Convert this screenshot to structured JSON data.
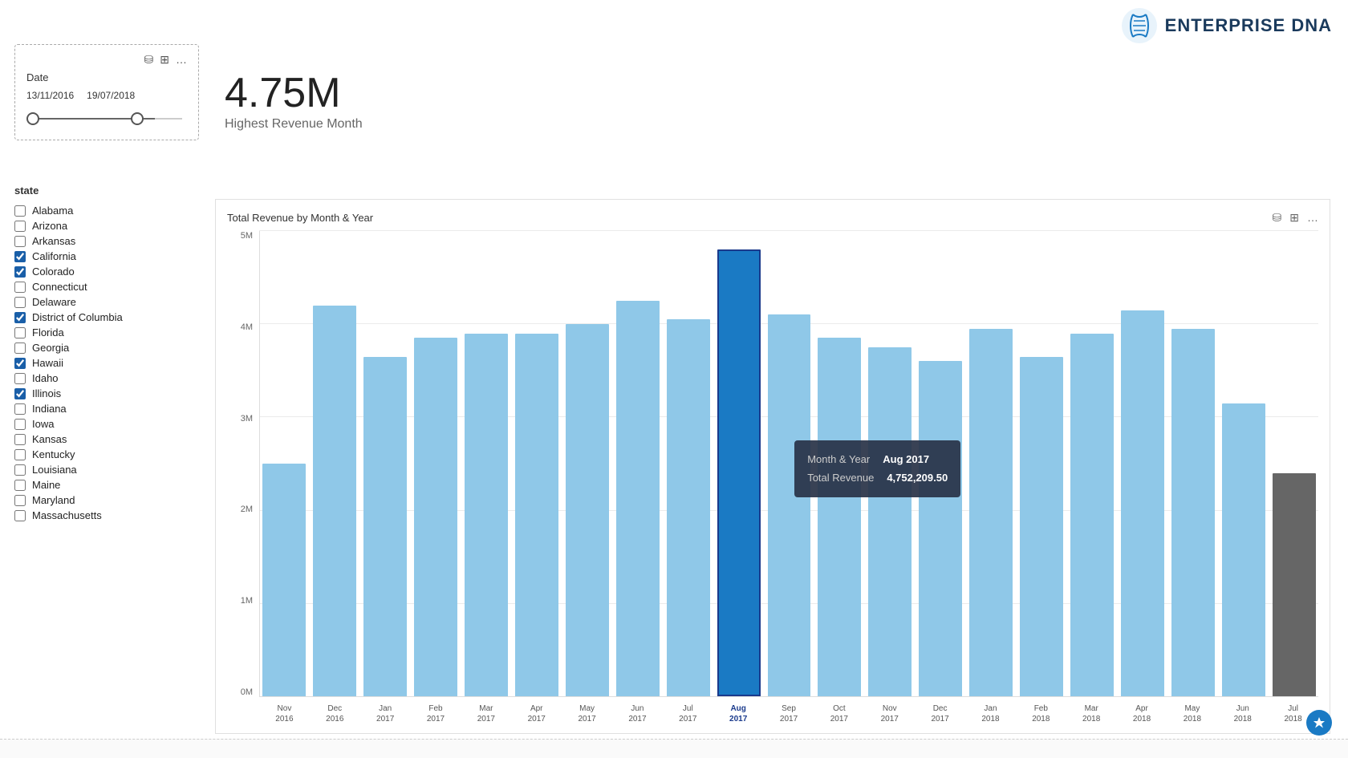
{
  "logo": {
    "text": "ENTERPRISE DNA"
  },
  "date_filter": {
    "label": "Date",
    "start": "13/11/2016",
    "end": "19/07/2018",
    "toolbar": {
      "filter_icon": "⛁",
      "table_icon": "⊞",
      "more_icon": "…"
    }
  },
  "kpi": {
    "value": "4.75M",
    "label": "Highest Revenue Month"
  },
  "state_filter": {
    "title": "state",
    "items": [
      {
        "label": "Alabama",
        "checked": false
      },
      {
        "label": "Arizona",
        "checked": false
      },
      {
        "label": "Arkansas",
        "checked": false
      },
      {
        "label": "California",
        "checked": true
      },
      {
        "label": "Colorado",
        "checked": true
      },
      {
        "label": "Connecticut",
        "checked": false
      },
      {
        "label": "Delaware",
        "checked": false
      },
      {
        "label": "District of Columbia",
        "checked": true
      },
      {
        "label": "Florida",
        "checked": false
      },
      {
        "label": "Georgia",
        "checked": false
      },
      {
        "label": "Hawaii",
        "checked": true
      },
      {
        "label": "Idaho",
        "checked": false
      },
      {
        "label": "Illinois",
        "checked": true
      },
      {
        "label": "Indiana",
        "checked": false
      },
      {
        "label": "Iowa",
        "checked": false
      },
      {
        "label": "Kansas",
        "checked": false
      },
      {
        "label": "Kentucky",
        "checked": false
      },
      {
        "label": "Louisiana",
        "checked": false
      },
      {
        "label": "Maine",
        "checked": false
      },
      {
        "label": "Maryland",
        "checked": false
      },
      {
        "label": "Massachusetts",
        "checked": false
      }
    ]
  },
  "chart": {
    "title": "Total Revenue by Month & Year",
    "y_labels": [
      "5M",
      "4M",
      "3M",
      "2M",
      "1M",
      "0M"
    ],
    "tooltip": {
      "month_year_label": "Month & Year",
      "month_year_value": "Aug 2017",
      "revenue_label": "Total Revenue",
      "revenue_value": "4,752,209.50"
    },
    "bars": [
      {
        "month": "Nov",
        "year": "2016",
        "height_pct": 50,
        "highlighted": false,
        "dark": false
      },
      {
        "month": "Dec",
        "year": "2016",
        "height_pct": 84,
        "highlighted": false,
        "dark": false
      },
      {
        "month": "Jan",
        "year": "2017",
        "height_pct": 73,
        "highlighted": false,
        "dark": false
      },
      {
        "month": "Feb",
        "year": "2017",
        "height_pct": 77,
        "highlighted": false,
        "dark": false
      },
      {
        "month": "Mar",
        "year": "2017",
        "height_pct": 78,
        "highlighted": false,
        "dark": false
      },
      {
        "month": "Apr",
        "year": "2017",
        "height_pct": 78,
        "highlighted": false,
        "dark": false
      },
      {
        "month": "May",
        "year": "2017",
        "height_pct": 80,
        "highlighted": false,
        "dark": false
      },
      {
        "month": "Jun",
        "year": "2017",
        "height_pct": 85,
        "highlighted": false,
        "dark": false
      },
      {
        "month": "Jul",
        "year": "2017",
        "height_pct": 81,
        "highlighted": false,
        "dark": false
      },
      {
        "month": "Aug",
        "year": "2017",
        "height_pct": 96,
        "highlighted": true,
        "dark": false
      },
      {
        "month": "Sep",
        "year": "2017",
        "height_pct": 82,
        "highlighted": false,
        "dark": false
      },
      {
        "month": "Oct",
        "year": "2017",
        "height_pct": 77,
        "highlighted": false,
        "dark": false
      },
      {
        "month": "Nov",
        "year": "2017",
        "height_pct": 75,
        "highlighted": false,
        "dark": false
      },
      {
        "month": "Dec",
        "year": "2017",
        "height_pct": 72,
        "highlighted": false,
        "dark": false
      },
      {
        "month": "Jan",
        "year": "2018",
        "height_pct": 79,
        "highlighted": false,
        "dark": false
      },
      {
        "month": "Feb",
        "year": "2018",
        "height_pct": 73,
        "highlighted": false,
        "dark": false
      },
      {
        "month": "Mar",
        "year": "2018",
        "height_pct": 78,
        "highlighted": false,
        "dark": false
      },
      {
        "month": "Apr",
        "year": "2018",
        "height_pct": 83,
        "highlighted": false,
        "dark": false
      },
      {
        "month": "May",
        "year": "2018",
        "height_pct": 79,
        "highlighted": false,
        "dark": false
      },
      {
        "month": "Jun",
        "year": "2018",
        "height_pct": 63,
        "highlighted": false,
        "dark": false
      },
      {
        "month": "Jul",
        "year": "2018",
        "height_pct": 48,
        "highlighted": false,
        "dark": true
      }
    ]
  }
}
